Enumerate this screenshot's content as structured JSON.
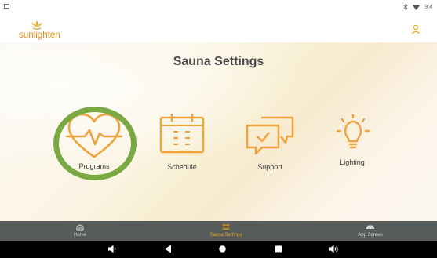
{
  "status_bar": {
    "time": "9:4"
  },
  "header": {
    "logo_text": "sunlighten"
  },
  "main": {
    "title": "Sauna Settings",
    "tiles": [
      {
        "label": "Programs",
        "icon": "heart-pulse-icon"
      },
      {
        "label": "Schedule",
        "icon": "calendar-icon"
      },
      {
        "label": "Support",
        "icon": "chat-bubbles-icon"
      },
      {
        "label": "Lighting",
        "icon": "lightbulb-icon"
      }
    ]
  },
  "bottom_nav": {
    "items": [
      {
        "label": "Home",
        "icon": "sauna-home-icon",
        "active": false
      },
      {
        "label": "Sauna Settings",
        "icon": "list-icon",
        "active": true
      },
      {
        "label": "App Screen",
        "icon": "car-icon",
        "active": false
      }
    ]
  },
  "colors": {
    "accent": "#e3a629",
    "icon_orange": "#f0a23a",
    "highlight_ring": "#7aa843",
    "nav_bg": "#555b59",
    "title_text": "#4a4a4a"
  }
}
